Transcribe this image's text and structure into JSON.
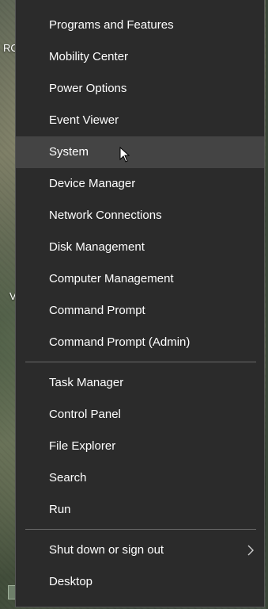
{
  "desktop": {
    "text_top": "RO",
    "text_mid": "V"
  },
  "menu": {
    "items": [
      {
        "label": "Programs and Features"
      },
      {
        "label": "Mobility Center"
      },
      {
        "label": "Power Options"
      },
      {
        "label": "Event Viewer"
      },
      {
        "label": "System",
        "highlighted": true
      },
      {
        "label": "Device Manager"
      },
      {
        "label": "Network Connections"
      },
      {
        "label": "Disk Management"
      },
      {
        "label": "Computer Management"
      },
      {
        "label": "Command Prompt"
      },
      {
        "label": "Command Prompt (Admin)"
      },
      {
        "label": "Task Manager"
      },
      {
        "label": "Control Panel"
      },
      {
        "label": "File Explorer"
      },
      {
        "label": "Search"
      },
      {
        "label": "Run"
      },
      {
        "label": "Shut down or sign out",
        "has_submenu": true
      },
      {
        "label": "Desktop"
      }
    ]
  },
  "colors": {
    "menu_bg": "#2b2b2b",
    "highlight": "#444444",
    "text": "#ffffff",
    "separator": "#6a6a6a"
  },
  "icons": {
    "submenu": "chevron-right-icon",
    "cursor": "mouse-pointer-icon"
  }
}
